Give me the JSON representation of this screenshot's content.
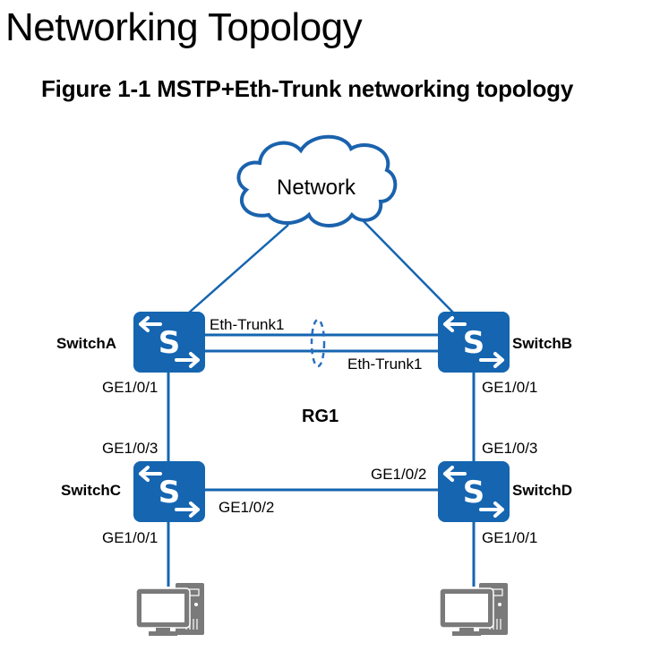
{
  "page": {
    "title": "Networking Topology",
    "figure_caption": "Figure 1-1 MSTP+Eth-Trunk networking topology"
  },
  "colors": {
    "switch_fill": "#1565b0",
    "link": "#1565b0",
    "cloud_stroke": "#1a62ad",
    "pc_gray": "#7a7a7a"
  },
  "cloud": {
    "label": "Network",
    "icon": "cloud-icon"
  },
  "region_label": "RG1",
  "switches": [
    {
      "id": "A",
      "name": "SwitchA",
      "icon": "switch-icon"
    },
    {
      "id": "B",
      "name": "SwitchB",
      "icon": "switch-icon"
    },
    {
      "id": "C",
      "name": "SwitchC",
      "icon": "switch-icon"
    },
    {
      "id": "D",
      "name": "SwitchD",
      "icon": "switch-icon"
    }
  ],
  "links": {
    "trunk_a_label": "Eth-Trunk1",
    "trunk_b_label": "Eth-Trunk1",
    "a_down": "GE1/0/1",
    "b_down": "GE1/0/1",
    "c_up": "GE1/0/3",
    "d_up": "GE1/0/3",
    "c_right": "GE1/0/2",
    "d_left": "GE1/0/2",
    "c_down": "GE1/0/1",
    "d_down": "GE1/0/1"
  },
  "hosts": [
    {
      "name": "pc-left",
      "icon": "pc-icon"
    },
    {
      "name": "pc-right",
      "icon": "pc-icon"
    }
  ]
}
